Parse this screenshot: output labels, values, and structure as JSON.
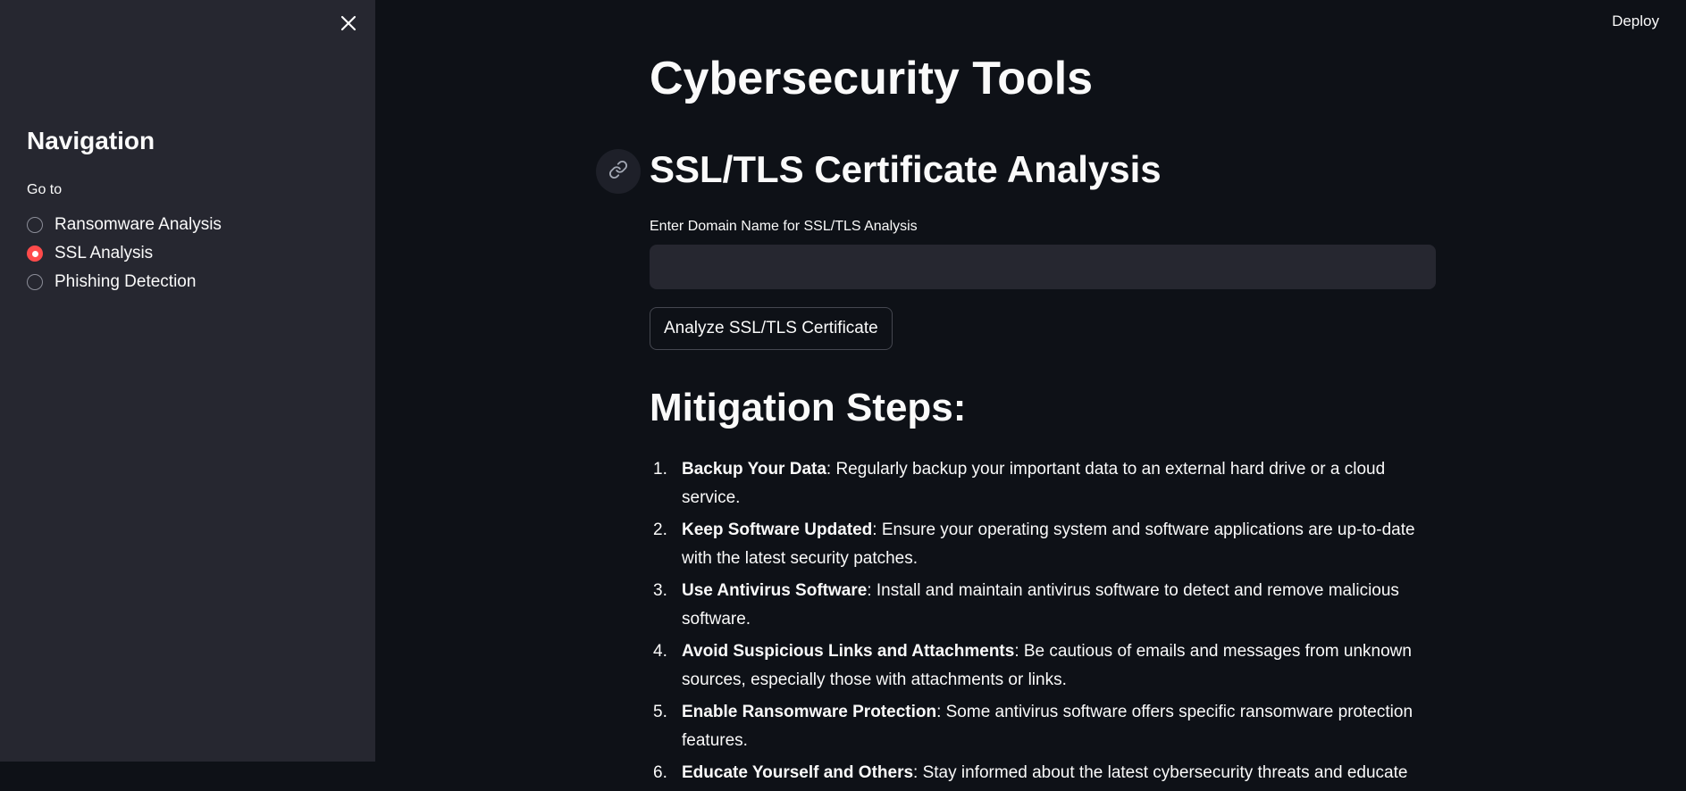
{
  "sidebar": {
    "nav_title": "Navigation",
    "radio_label": "Go to",
    "options": [
      {
        "label": "Ransomware Analysis",
        "selected": false
      },
      {
        "label": "SSL Analysis",
        "selected": true
      },
      {
        "label": "Phishing Detection",
        "selected": false
      }
    ],
    "close_icon": "close-icon"
  },
  "header": {
    "deploy_label": "Deploy"
  },
  "main": {
    "page_title": "Cybersecurity Tools",
    "section_title": "SSL/TLS Certificate Analysis",
    "input_label": "Enter Domain Name for SSL/TLS Analysis",
    "input_value": "",
    "input_placeholder": "",
    "button_label": "Analyze SSL/TLS Certificate",
    "mitigation_title": "Mitigation Steps:",
    "steps": [
      {
        "num": "1.",
        "title": "Backup Your Data",
        "text": ": Regularly backup your important data to an external hard drive or a cloud service."
      },
      {
        "num": "2.",
        "title": "Keep Software Updated",
        "text": ": Ensure your operating system and software applications are up-to-date with the latest security patches."
      },
      {
        "num": "3.",
        "title": "Use Antivirus Software",
        "text": ": Install and maintain antivirus software to detect and remove malicious software."
      },
      {
        "num": "4.",
        "title": "Avoid Suspicious Links and Attachments",
        "text": ": Be cautious of emails and messages from unknown sources, especially those with attachments or links."
      },
      {
        "num": "5.",
        "title": "Enable Ransomware Protection",
        "text": ": Some antivirus software offers specific ransomware protection features."
      },
      {
        "num": "6.",
        "title": "Educate Yourself and Others",
        "text": ": Stay informed about the latest cybersecurity threats and educate"
      }
    ]
  },
  "colors": {
    "background": "#0e1117",
    "sidebar": "#262730",
    "accent": "#ff4b4b",
    "text": "#fafafa"
  }
}
